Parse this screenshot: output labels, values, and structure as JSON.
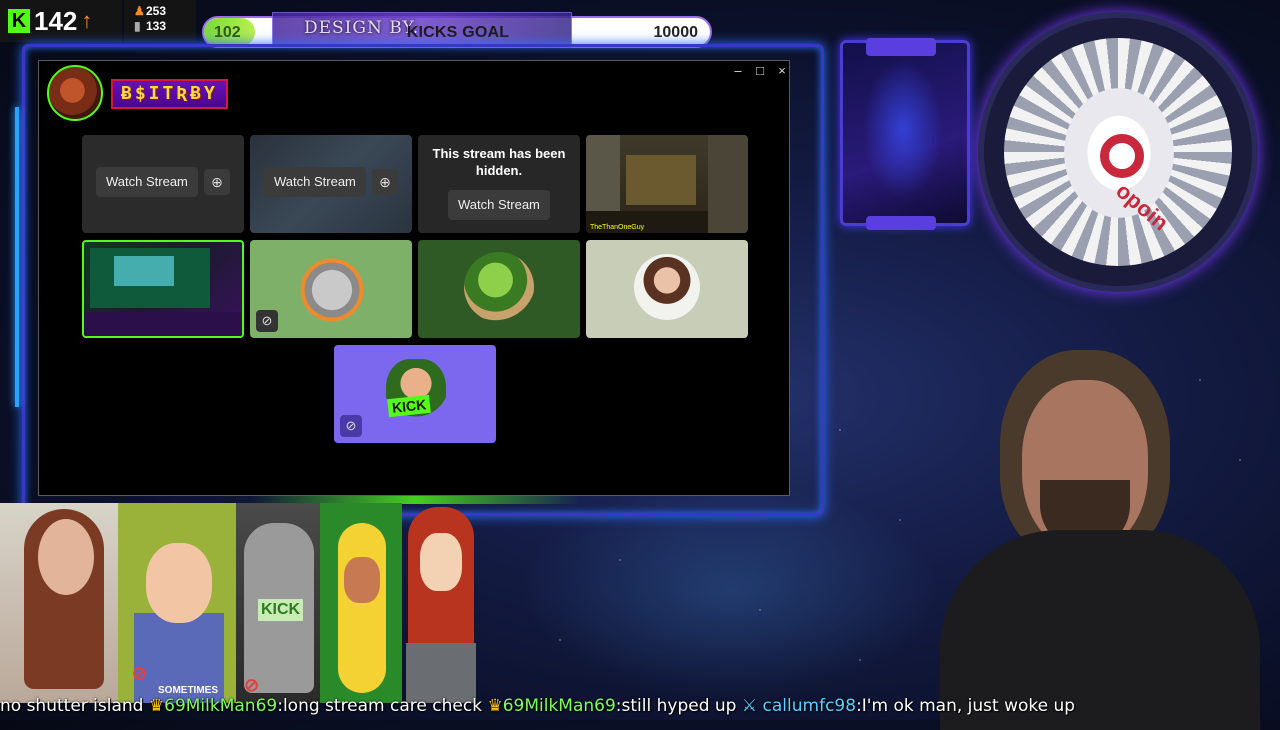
{
  "stats": {
    "kick_logo": "K",
    "kick_count": "142",
    "arrow": "↑",
    "stat_a": "253",
    "stat_b": "133"
  },
  "goal": {
    "current": "102",
    "label": "KICKS GOAL",
    "max": "10000",
    "progress": 0.0102,
    "design_text": "DESIGN BY:"
  },
  "window": {
    "controls": {
      "minimize": "–",
      "maximize": "□",
      "close": "×"
    },
    "streamer_name": "Ƀ$ITƦɃY",
    "tiles": [
      {
        "watch_label": "Watch Stream",
        "icon": "clock-search-icon"
      },
      {
        "watch_label": "Watch Stream",
        "icon": "clock-search-icon"
      },
      {
        "hidden_text": "This stream has been hidden.",
        "watch_label": "Watch Stream"
      },
      {
        "overlay_name": "TheThanOneGuy"
      },
      {
        "kind": "selected-stream"
      },
      {
        "icon": "eye-off-icon"
      },
      {
        "kind": "avatar-pepe"
      },
      {
        "kind": "avatar-woman"
      },
      {
        "kick_text": "KICK",
        "icon": "eye-off-icon"
      }
    ]
  },
  "overlay": {
    "brand": "opoin",
    "bottom_tags": {
      "sometimes": "SOMETIMES",
      "kick": "KICK"
    }
  },
  "chat": {
    "messages": [
      {
        "user": "",
        "text": "no shutter island"
      },
      {
        "user": "69MilkMan69",
        "text": "long stream care check"
      },
      {
        "user": "69MilkMan69",
        "text": "still hyped up"
      },
      {
        "user": "callumfc98",
        "text": "I'm ok man, just woke up"
      }
    ]
  },
  "colors": {
    "kick_green": "#53fc18",
    "frame_blue": "#3a37c8",
    "accent_purple": "#7b68ee"
  }
}
